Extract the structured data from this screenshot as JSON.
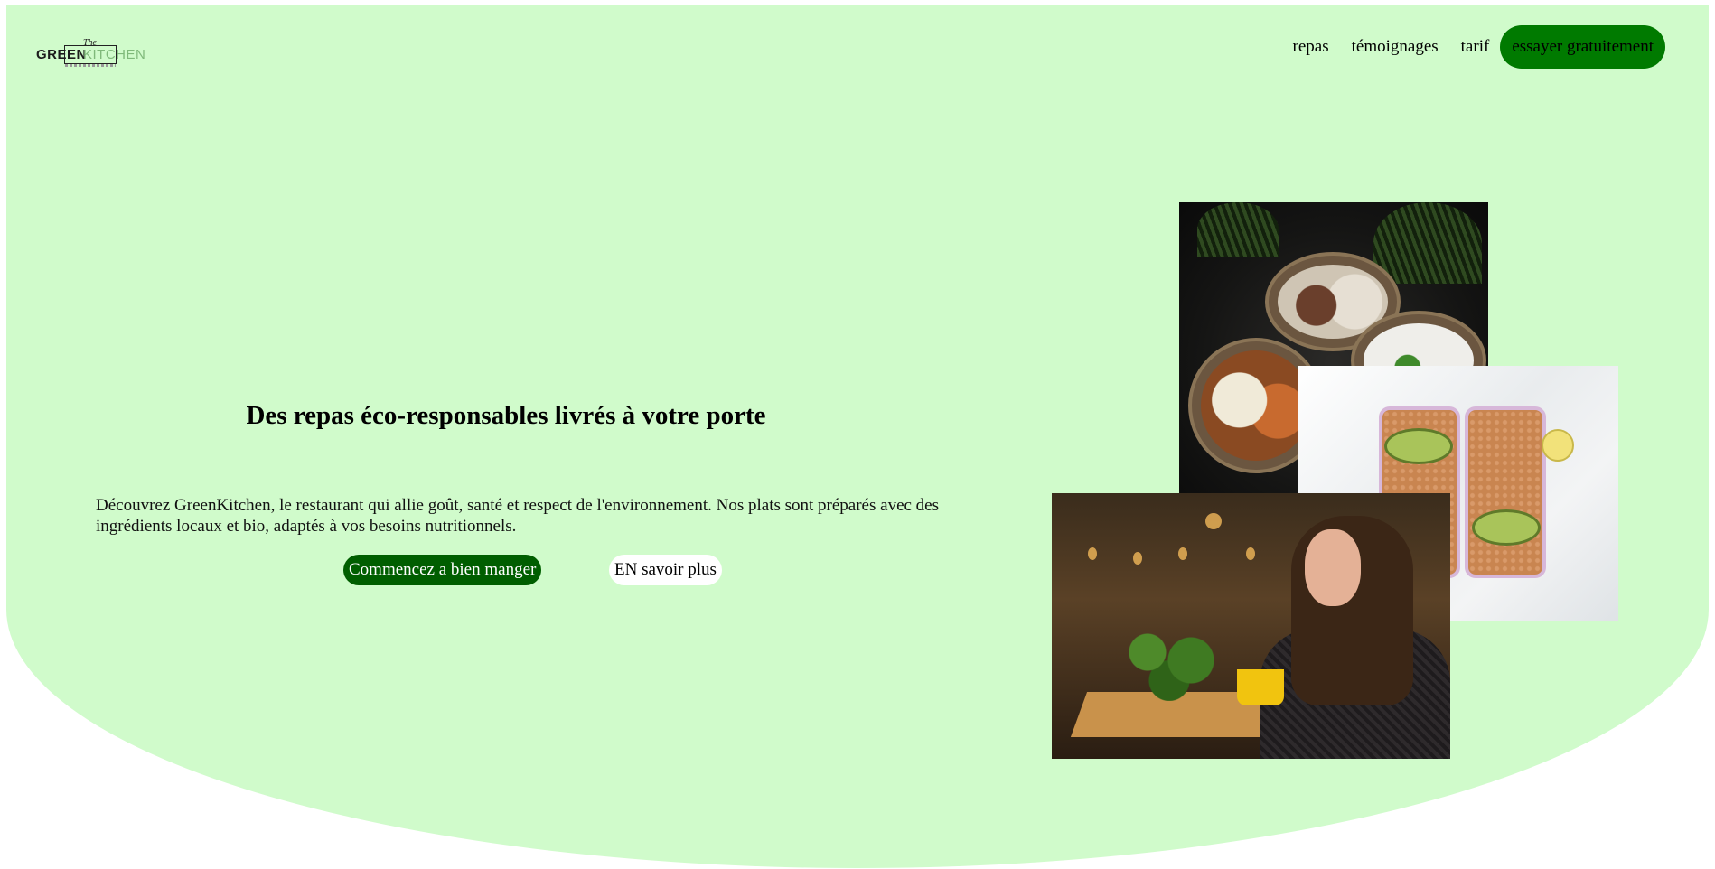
{
  "brand": {
    "logo_the": "The",
    "logo_green": "GREEN",
    "logo_kitchen": "KITCHEN"
  },
  "nav": {
    "items": [
      {
        "label": "repas"
      },
      {
        "label": "témoignages"
      },
      {
        "label": "tarif"
      }
    ],
    "cta": "essayer gratuitement"
  },
  "hero": {
    "title": "Des repas éco-responsables livrés à votre porte",
    "description": "Découvrez GreenKitchen, le restaurant qui allie goût, santé et respect de l'environnement. Nos plats sont préparés avec des ingrédients locaux et bio, adaptés à vos besoins nutritionnels.",
    "primary_button": "Commencez a bien manger",
    "secondary_button": "EN savoir plus"
  },
  "colors": {
    "hero_background": "#d0fbcb",
    "cta_green": "#007a00",
    "primary_button_green": "#005e00"
  }
}
